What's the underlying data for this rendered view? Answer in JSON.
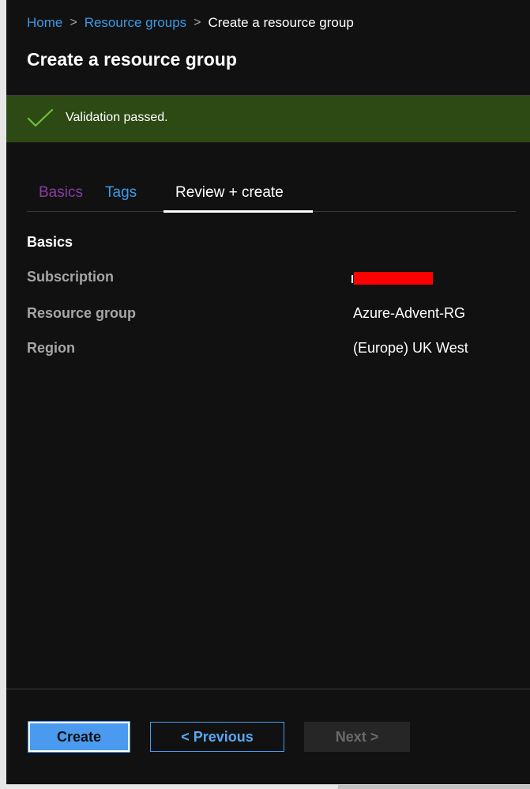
{
  "breadcrumb": {
    "items": [
      "Home",
      "Resource groups"
    ],
    "current": "Create a resource group",
    "separator": ">"
  },
  "page": {
    "title": "Create a resource group"
  },
  "banner": {
    "text": "Validation passed.",
    "icon": "checkmark-icon",
    "color": "#2e4a14"
  },
  "tabs": [
    {
      "label": "Basics",
      "state": "visited"
    },
    {
      "label": "Tags",
      "state": "link"
    },
    {
      "label": "Review + create",
      "state": "selected"
    }
  ],
  "summary": {
    "section_title": "Basics",
    "rows": [
      {
        "label": "Subscription",
        "value": "",
        "redacted": true
      },
      {
        "label": "Resource group",
        "value": "Azure-Advent-RG"
      },
      {
        "label": "Region",
        "value": "(Europe) UK West"
      }
    ]
  },
  "footer": {
    "create_label": "Create",
    "previous_label": "< Previous",
    "next_label": "Next >",
    "next_disabled": true
  },
  "colors": {
    "background": "#111111",
    "accent": "#4a9bf0",
    "link": "#3b9ae8",
    "visited": "#8a3aa8",
    "redaction": "#ff0000"
  }
}
